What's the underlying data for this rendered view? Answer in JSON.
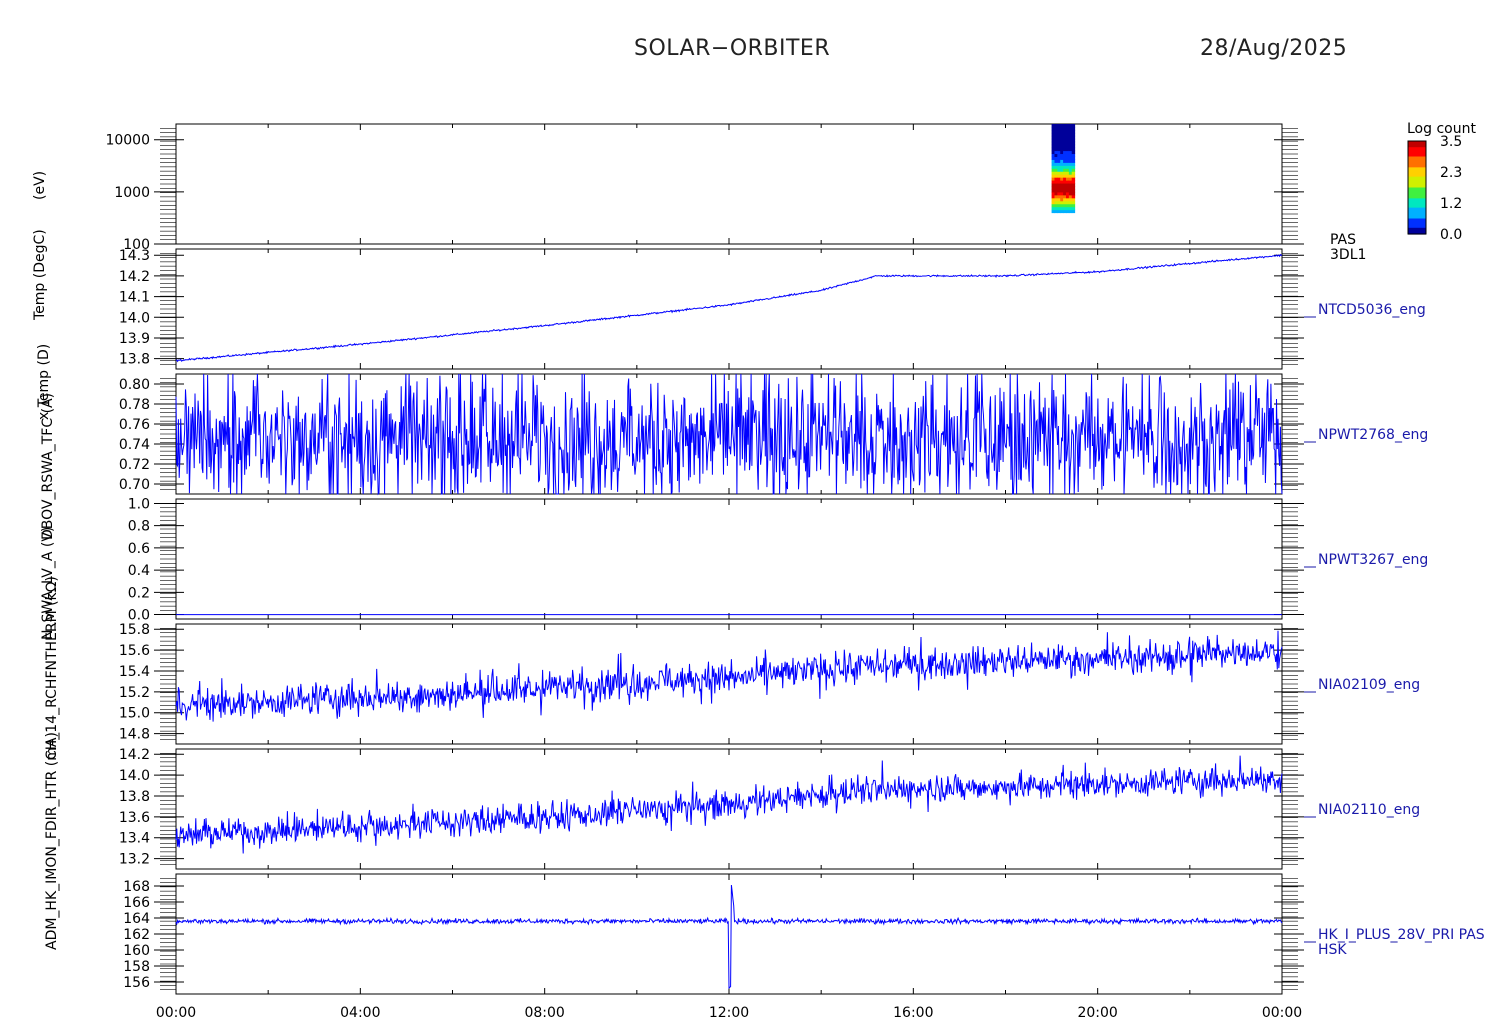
{
  "header": {
    "title": "SOLAR−ORBITER",
    "date": "28/Aug/2025"
  },
  "colorbar": {
    "label": "Log count",
    "ticks": [
      "3.5",
      "2.3",
      "1.2",
      "0.0"
    ],
    "colors": [
      "#00009a",
      "#0030ff",
      "#00b0ff",
      "#00e8c0",
      "#40f040",
      "#d0f000",
      "#ffd000",
      "#ff7000",
      "#ff0000",
      "#c00000"
    ]
  },
  "y_axis_labels": [
    "(eV)",
    "Temp (DegC)",
    "x Temp (D)",
    "DBOV_RSWA_TFC (A)",
    "N_SWA_LV_A (V)",
    "CH_14_RCHFNTHERM (kΩ)",
    "ADM_HK_IMON_FDIR_HTR (mA)"
  ],
  "chart_data": {
    "type": "line",
    "x_ticks": [
      "00:00",
      "04:00",
      "08:00",
      "12:00",
      "16:00",
      "20:00",
      "00:00"
    ],
    "x_range_hours": [
      0,
      24
    ],
    "line_color": "#0000ff",
    "panels": [
      {
        "type": "heatmap",
        "label_lines": [
          "PAS",
          "3DL1"
        ],
        "y_ticks": [
          "10000",
          "1000",
          "100"
        ],
        "y_scale": "log",
        "ylim": [
          100,
          20000
        ],
        "data_window_hours": [
          19.0,
          19.5
        ],
        "energy_range": [
          400,
          20000
        ],
        "peak_energy": 1200
      },
      {
        "label_lines": [
          "NTCD5036_eng"
        ],
        "y_ticks": [
          "14.3",
          "14.2",
          "14.1",
          "14.0",
          "13.9",
          "13.8"
        ],
        "ylim": [
          13.75,
          14.33
        ],
        "trend": [
          [
            0,
            13.79
          ],
          [
            4,
            13.87
          ],
          [
            8,
            13.96
          ],
          [
            12,
            14.06
          ],
          [
            14,
            14.13
          ],
          [
            15.2,
            14.2
          ],
          [
            18,
            14.2
          ],
          [
            20,
            14.22
          ],
          [
            22,
            14.26
          ],
          [
            24,
            14.3
          ]
        ],
        "noise": 0.002,
        "spikes": 0
      },
      {
        "label_lines": [
          "NPWT2768_eng"
        ],
        "y_ticks": [
          "0.80",
          "0.78",
          "0.76",
          "0.74",
          "0.72",
          "0.70"
        ],
        "ylim": [
          0.69,
          0.81
        ],
        "trend": [
          [
            0,
            0.745
          ],
          [
            24,
            0.745
          ]
        ],
        "noise": 0.025,
        "spikes": 0.4
      },
      {
        "label_lines": [
          "NPWT3267_eng"
        ],
        "y_ticks": [
          "1.0",
          "0.8",
          "0.6",
          "0.4",
          "0.2",
          "0.0"
        ],
        "ylim": [
          -0.04,
          1.04
        ],
        "trend": [
          [
            0,
            0.0
          ],
          [
            24,
            0.0
          ]
        ],
        "noise": 0.0,
        "spikes": 0
      },
      {
        "label_lines": [
          "NIA02109_eng"
        ],
        "y_ticks": [
          "15.8",
          "15.6",
          "15.4",
          "15.2",
          "15.0",
          "14.8"
        ],
        "ylim": [
          14.7,
          15.85
        ],
        "trend": [
          [
            0,
            15.07
          ],
          [
            3,
            15.13
          ],
          [
            6,
            15.18
          ],
          [
            9,
            15.27
          ],
          [
            12,
            15.33
          ],
          [
            15,
            15.45
          ],
          [
            18,
            15.5
          ],
          [
            21,
            15.53
          ],
          [
            24,
            15.6
          ]
        ],
        "noise": 0.07,
        "spikes": 0.2
      },
      {
        "label_lines": [
          "NIA02110_eng"
        ],
        "y_ticks": [
          "14.2",
          "14.0",
          "13.8",
          "13.6",
          "13.4",
          "13.2"
        ],
        "ylim": [
          13.1,
          14.25
        ],
        "trend": [
          [
            0,
            13.42
          ],
          [
            3,
            13.49
          ],
          [
            6,
            13.55
          ],
          [
            9,
            13.62
          ],
          [
            12,
            13.72
          ],
          [
            15,
            13.86
          ],
          [
            18,
            13.89
          ],
          [
            21,
            13.93
          ],
          [
            24,
            13.97
          ]
        ],
        "noise": 0.06,
        "spikes": 0.2
      },
      {
        "label_lines": [
          "HK_I_PLUS_28V_PRI PAS",
          "HSK"
        ],
        "y_ticks": [
          "168",
          "166",
          "164",
          "162",
          "160",
          "158",
          "156"
        ],
        "ylim": [
          154.5,
          169.5
        ],
        "trend": [
          [
            0,
            163.6
          ],
          [
            24,
            163.6
          ]
        ],
        "noise": 0.15,
        "spikes": 0,
        "excursion": {
          "hour": 12.05,
          "min": 155.2,
          "max": 168.2
        }
      }
    ]
  }
}
